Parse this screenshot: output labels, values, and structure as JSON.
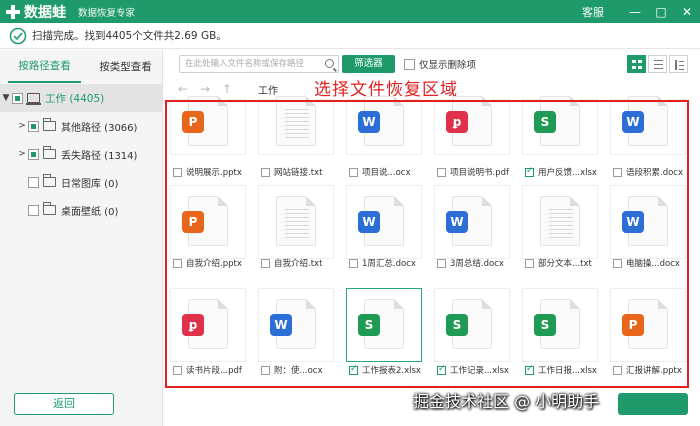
{
  "app": {
    "name": "数据蛙",
    "subtitle": "数据恢复专家",
    "support": "客服",
    "minimize": "—",
    "maximize": "□",
    "close": "✕"
  },
  "status": {
    "text": "扫描完成。找到4405个文件共2.69 GB。"
  },
  "sidebar": {
    "tabs": [
      "按路径查看",
      "按类型查看"
    ],
    "root": {
      "label": "工作 (4405)"
    },
    "items": [
      {
        "label": "其他路径 (3066)"
      },
      {
        "label": "丢失路径 (1314)"
      },
      {
        "label": "日常图库 (0)"
      },
      {
        "label": "桌面壁纸 (0)"
      }
    ]
  },
  "toolbar": {
    "search_placeholder": "在此处输入文件名称或保存路径",
    "filter_label": "筛选器",
    "only_deleted_label": "仅显示删除项"
  },
  "nav": {
    "back": "←",
    "forward": "→",
    "up": "↑",
    "breadcrumb": "工作"
  },
  "annotation": {
    "title": "选择文件恢复区域"
  },
  "colors": {
    "accent": "#1f9b6b",
    "annotation_red": "#e1201f",
    "ppt": "#e8661b",
    "word": "#2b6fd6",
    "excel": "#1f9b56",
    "pdf": "#e0304a"
  },
  "files": [
    {
      "name": "说明展示.pptx",
      "type": "ppt",
      "checked": false,
      "selected": false
    },
    {
      "name": "网站链接.txt",
      "type": "txt",
      "checked": false,
      "selected": false
    },
    {
      "name": "项目说...ocx",
      "type": "word",
      "checked": false,
      "selected": false
    },
    {
      "name": "项目说明书.pdf",
      "type": "pdf",
      "checked": false,
      "selected": false
    },
    {
      "name": "用户反馈...xlsx",
      "type": "excel",
      "checked": true,
      "selected": false
    },
    {
      "name": "语段积累.docx",
      "type": "word",
      "checked": false,
      "selected": false
    },
    {
      "name": "自我介绍.pptx",
      "type": "ppt",
      "checked": false,
      "selected": false
    },
    {
      "name": "自我介绍.txt",
      "type": "txt",
      "checked": false,
      "selected": false
    },
    {
      "name": "1周汇总.docx",
      "type": "word",
      "checked": false,
      "selected": false
    },
    {
      "name": "3周总结.docx",
      "type": "word",
      "checked": false,
      "selected": false
    },
    {
      "name": "部分文本...txt",
      "type": "txt",
      "checked": false,
      "selected": false
    },
    {
      "name": "电脑操...docx",
      "type": "word",
      "checked": false,
      "selected": false
    },
    {
      "name": "读书片段...pdf",
      "type": "pdf",
      "checked": false,
      "selected": false
    },
    {
      "name": "附：使...ocx",
      "type": "word",
      "checked": false,
      "selected": false
    },
    {
      "name": "工作报表2.xlsx",
      "type": "excel",
      "checked": true,
      "selected": true
    },
    {
      "name": "工作记录...xlsx",
      "type": "excel",
      "checked": true,
      "selected": false
    },
    {
      "name": "工作日报...xlsx",
      "type": "excel",
      "checked": true,
      "selected": false
    },
    {
      "name": "汇报讲解.pptx",
      "type": "ppt",
      "checked": false,
      "selected": false
    }
  ],
  "footer": {
    "back_label": "返回",
    "watermark": "掘金技术社区 @ 小明助手"
  }
}
